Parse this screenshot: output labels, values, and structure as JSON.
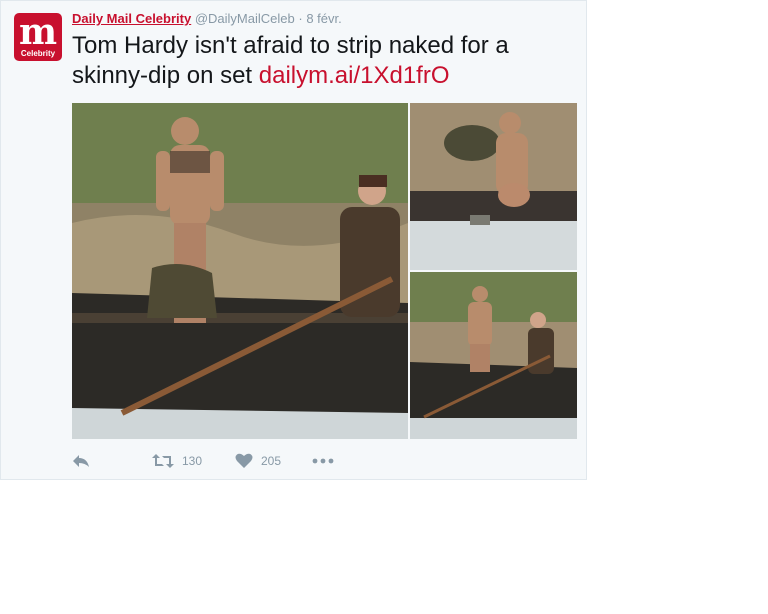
{
  "tweet": {
    "avatar": {
      "letter": "m",
      "caption": "Celebrity",
      "color": "#c8102e"
    },
    "author_name": "Daily Mail Celebrity",
    "handle": "@DailyMailCeleb",
    "separator": "·",
    "date": "8 févr.",
    "text": "Tom Hardy isn't afraid to strip naked for a skinny-dip on set",
    "link": "dailym.ai/1Xd1frO",
    "media": [
      {
        "icon": "photo-main-man-in-boat"
      },
      {
        "icon": "photo-man-wading-in-water"
      },
      {
        "icon": "photo-men-in-boat"
      }
    ],
    "actions": {
      "reply_icon": "reply-icon",
      "retweet_icon": "retweet-icon",
      "retweet_count": "130",
      "like_icon": "heart-icon",
      "like_count": "205",
      "more_icon": "more-icon"
    },
    "colors": {
      "brand": "#c8102e",
      "muted": "#8899a6",
      "background": "#f5f8fa"
    }
  }
}
